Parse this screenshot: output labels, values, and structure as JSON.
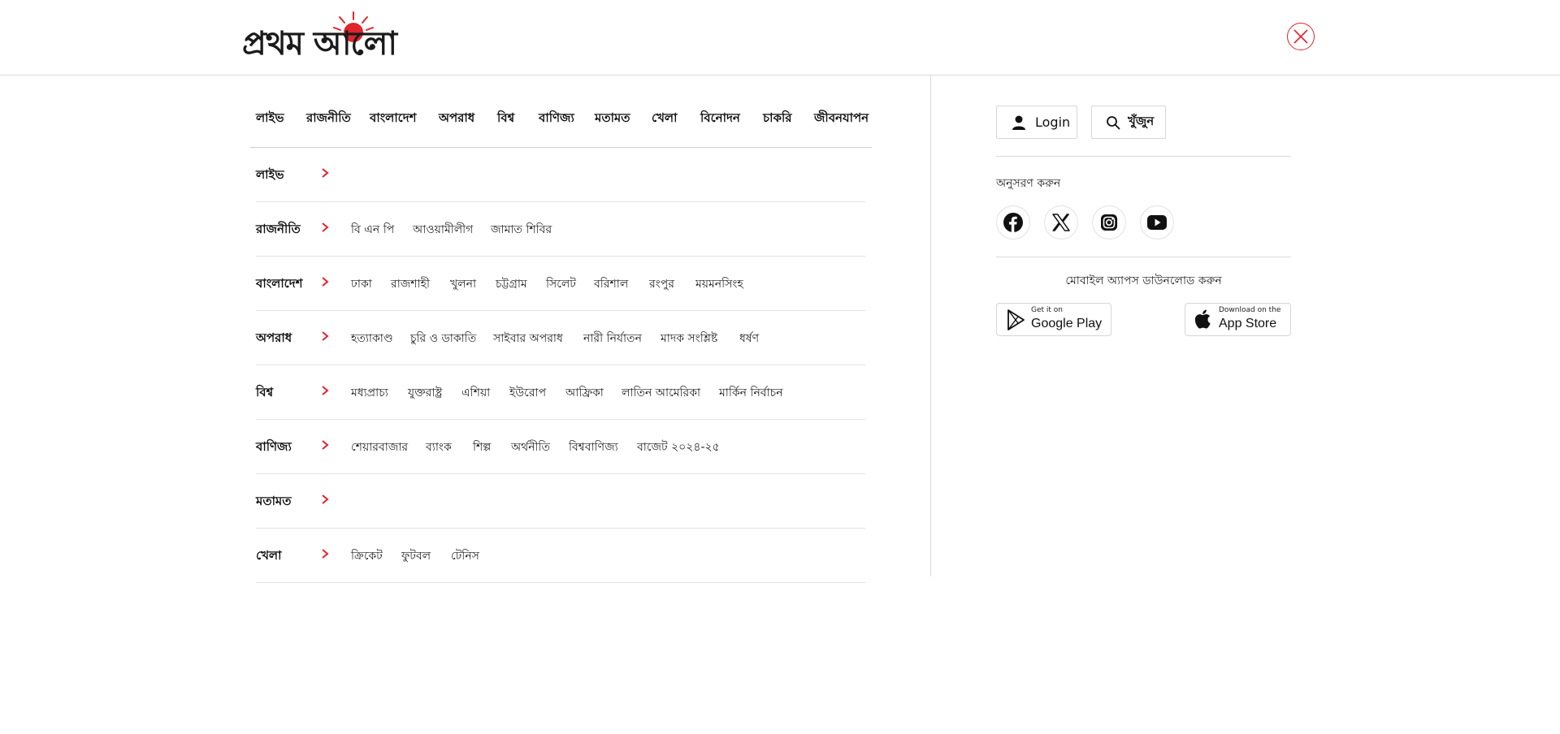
{
  "header": {
    "logo_text": "প্রথম আলো",
    "close_icon": "close-icon",
    "accent_color": "#e0242c"
  },
  "topnav": [
    "লাইভ",
    "রাজনীতি",
    "বাংলাদেশ",
    "অপরাধ",
    "বিশ্ব",
    "বাণিজ্য",
    "মতামত",
    "খেলা",
    "বিনোদন",
    "চাকরি",
    "জীবনযাপন"
  ],
  "sections": [
    {
      "label": "লাইভ",
      "subs": []
    },
    {
      "label": "রাজনীতি",
      "subs": [
        "বি এন পি",
        "আওয়ামীলীগ",
        "জামাত শিবির"
      ]
    },
    {
      "label": "বাংলাদেশ",
      "subs": [
        "ঢাকা",
        "রাজশাহী",
        "খুলনা",
        "চট্টগ্রাম",
        "সিলেট",
        "বরিশাল",
        "রংপুর",
        "ময়মনসিংহ"
      ]
    },
    {
      "label": "অপরাধ",
      "subs": [
        "হত্যাকাণ্ড",
        "চুরি ও ডাকাতি",
        "সাইবার অপরাধ",
        "নারী নির্যাতন",
        "মাদক সংশ্লিষ্ট",
        "ধর্ষণ"
      ]
    },
    {
      "label": "বিশ্ব",
      "subs": [
        "মধ্যপ্রাচ্য",
        "যুক্তরাষ্ট্র",
        "এশিয়া",
        "ইউরোপ",
        "আফ্রিকা",
        "লাতিন আমেরিকা",
        "মার্কিন নির্বাচন"
      ]
    },
    {
      "label": "বাণিজ্য",
      "subs": [
        "শেয়ারবাজার",
        "ব্যাংক",
        "শিল্প",
        "অর্থনীতি",
        "বিশ্ববাণিজ্য",
        "বাজেট ২০২৪-২৫"
      ]
    },
    {
      "label": "মতামত",
      "subs": []
    },
    {
      "label": "খেলা",
      "subs": [
        "ক্রিকেট",
        "ফুটবল",
        "টেনিস"
      ]
    }
  ],
  "right": {
    "login_label": "Login",
    "search_label": "খুঁজুন",
    "follow_label": "অনুসরণ করুন",
    "socials": [
      "facebook-icon",
      "x-icon",
      "instagram-icon",
      "youtube-icon"
    ],
    "apps_label": "মোবাইল অ্যাপস ডাউনলোড করুন",
    "google_play": {
      "small": "Get it on",
      "big": "Google Play"
    },
    "app_store": {
      "small": "Download on the",
      "big": "App Store"
    }
  }
}
